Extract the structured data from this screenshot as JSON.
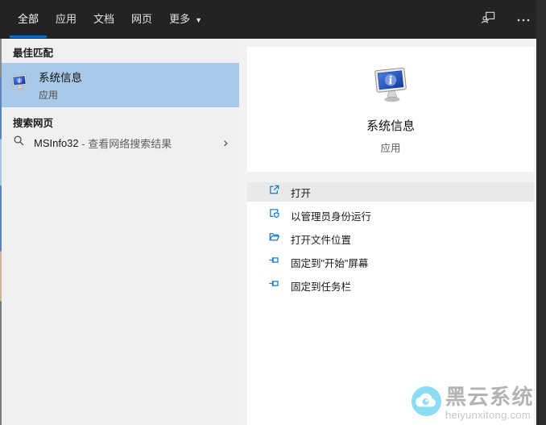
{
  "header": {
    "tabs": [
      {
        "label": "全部",
        "active": true
      },
      {
        "label": "应用",
        "active": false
      },
      {
        "label": "文档",
        "active": false
      },
      {
        "label": "网页",
        "active": false
      },
      {
        "label": "更多",
        "active": false,
        "has_dropdown": true
      }
    ],
    "icons": [
      "feedback-icon",
      "more-options-icon"
    ]
  },
  "left_panel": {
    "best_match": {
      "section_label": "最佳匹配",
      "item": {
        "title": "系统信息",
        "subtitle": "应用",
        "icon": "system-info-icon",
        "highlighted": true
      }
    },
    "search_web": {
      "section_label": "搜索网页",
      "item": {
        "query": "MSInfo32",
        "suffix": " - 查看网络搜索结果",
        "icon": "search-icon",
        "chevron": "›"
      }
    }
  },
  "right_panel": {
    "app": {
      "title": "系统信息",
      "subtitle": "应用",
      "icon": "system-info-icon"
    },
    "actions": [
      {
        "label": "打开",
        "icon": "launch-icon",
        "highlighted": true
      },
      {
        "label": "以管理员身份运行",
        "icon": "admin-shield-icon",
        "highlighted": false
      },
      {
        "label": "打开文件位置",
        "icon": "folder-location-icon",
        "highlighted": false
      },
      {
        "label": "固定到\"开始\"屏幕",
        "icon": "pin-icon",
        "highlighted": false
      },
      {
        "label": "固定到任务栏",
        "icon": "pin-icon",
        "highlighted": false
      }
    ]
  },
  "watermark": {
    "name": "黑云系统",
    "url": "heiyunxitong.com"
  },
  "colors": {
    "accent": "#0d6ec0",
    "header_bg": "#232323",
    "panel_bg": "#f0f0f0",
    "best_match_highlight": "#a9c9e8",
    "card_bg": "#ffffff",
    "action_highlight": "#e9e9e9",
    "action_icon_blue": "#0f78d0",
    "right_edge": "#2b2b2b",
    "watermark_cyan": "#8ddcf6"
  }
}
